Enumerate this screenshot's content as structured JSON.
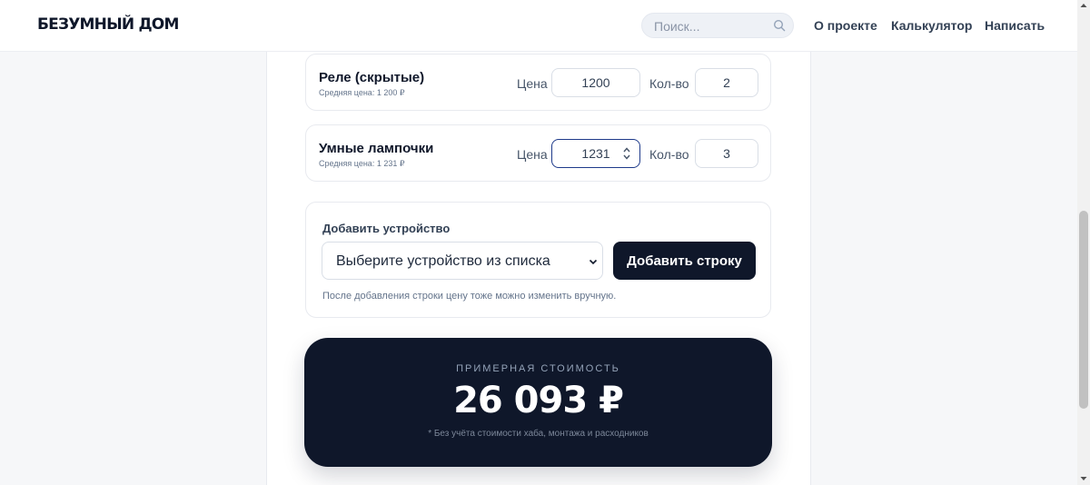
{
  "header": {
    "logo": "БЕЗУМНЫЙ ДОМ",
    "search_placeholder": "Поиск...",
    "nav": [
      "О проекте",
      "Калькулятор",
      "Написать"
    ]
  },
  "rows": [
    {
      "name": "Реле (скрытые)",
      "avg": "Средняя цена: 1 200 ₽",
      "price_label": "Цена",
      "price": "1200",
      "qty_label": "Кол-во",
      "qty": "2"
    },
    {
      "name": "Умные лампочки",
      "avg": "Средняя цена: 1 231 ₽",
      "price_label": "Цена",
      "price": "1231",
      "qty_label": "Кол-во",
      "qty": "3"
    }
  ],
  "add_device": {
    "title": "Добавить устройство",
    "select_value": "Выберите устройство из списка",
    "button": "Добавить строку",
    "hint": "После добавления строки цену тоже можно изменить вручную."
  },
  "total": {
    "label": "ПРИМЕРНАЯ СТОИМОСТЬ",
    "value": "26 093 ₽",
    "note": "* Без учёта стоимости хаба, монтажа и расходников"
  },
  "colors": {
    "accent": "#0f172a",
    "focus": "#1e3a8a",
    "bg": "#f6f7f9"
  }
}
